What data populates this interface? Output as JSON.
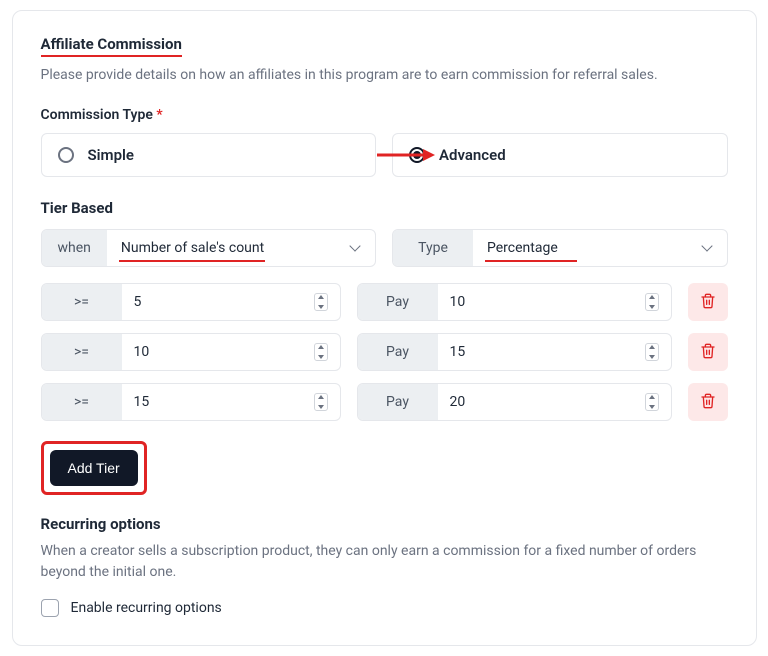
{
  "section": {
    "title": "Affiliate Commission",
    "desc": "Please provide details on how an affiliates in this program are to earn commission for referral sales."
  },
  "commissionType": {
    "label": "Commission Type",
    "options": {
      "simple": "Simple",
      "advanced": "Advanced"
    },
    "selected": "advanced"
  },
  "tierBased": {
    "title": "Tier Based",
    "whenLabel": "when",
    "whenValue": "Number of sale's count",
    "typeLabel": "Type",
    "typeValue": "Percentage"
  },
  "tiers": [
    {
      "op": ">=",
      "threshold": "5",
      "payLabel": "Pay",
      "payValue": "10"
    },
    {
      "op": ">=",
      "threshold": "10",
      "payLabel": "Pay",
      "payValue": "15"
    },
    {
      "op": ">=",
      "threshold": "15",
      "payLabel": "Pay",
      "payValue": "20"
    }
  ],
  "addTier": "Add Tier",
  "recurring": {
    "title": "Recurring options",
    "desc": "When a creator sells a subscription product, they can only earn a commission for a fixed number of orders beyond the initial one.",
    "checkboxLabel": "Enable recurring options",
    "checked": false
  },
  "colors": {
    "accent": "#e02424",
    "dark": "#111827"
  }
}
